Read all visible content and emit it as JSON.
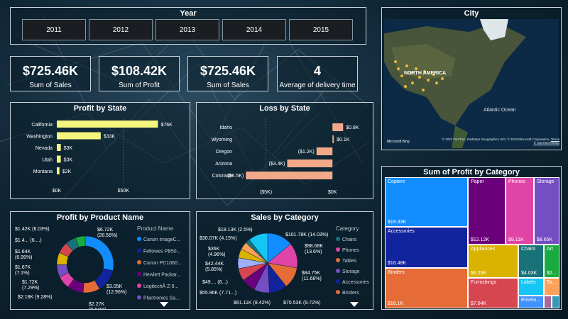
{
  "year_filter": {
    "title": "Year",
    "years": [
      "2011",
      "2012",
      "2013",
      "2014",
      "2015"
    ]
  },
  "kpis": [
    {
      "value": "$725.46K",
      "label": "Sum of Sales"
    },
    {
      "value": "$108.42K",
      "label": "Sum of Profit"
    },
    {
      "value": "$725.46K",
      "label": "Sum of Sales"
    },
    {
      "value": "4",
      "label": "Average of delivery time"
    }
  ],
  "city_map": {
    "title": "City",
    "continent": "NORTH AMERICA",
    "ocean": "Atlantic Ocean",
    "copyright": "© 2023 TomTom, Earthstar Geographics SIO, © 2023 Microsoft Corporation,",
    "terms": "Terms",
    "osm": "© OpenStreetMap",
    "bing": "Microsoft Bing"
  },
  "profit_by_state": {
    "title": "Profit by State",
    "chart_data": {
      "type": "bar",
      "orientation": "horizontal",
      "categories": [
        "California",
        "Washington",
        "Nevada",
        "Utah",
        "Montana"
      ],
      "values": [
        76,
        33,
        3,
        3,
        2
      ],
      "labels": [
        "$76K",
        "$33K",
        "$3K",
        "$3K",
        "$2K"
      ],
      "xticks": [
        "$0K",
        "$50K"
      ],
      "xlim": [
        0,
        80
      ],
      "color": "#f4f67d"
    }
  },
  "loss_by_state": {
    "title": "Loss by State",
    "chart_data": {
      "type": "bar",
      "orientation": "horizontal",
      "categories": [
        "Idaho",
        "Wyoming",
        "Oregon",
        "Arizona",
        "Colorado"
      ],
      "values": [
        0.8,
        0.1,
        -1.2,
        -3.4,
        -6.5
      ],
      "labels": [
        "$0.8K",
        "$0.1K",
        "($1.2K)",
        "($3.4K)",
        "($6.5K)"
      ],
      "xticks": [
        "($5K)",
        "$0K"
      ],
      "xlim": [
        -7,
        1
      ],
      "color": "#f2a98a"
    }
  },
  "profit_by_category": {
    "title": "Sum of Profit by Category",
    "chart_data": {
      "type": "treemap",
      "items": [
        {
          "name": "Copiers",
          "value": "$19.33K",
          "color": "#118dff"
        },
        {
          "name": "Accessories",
          "value": "$16.48K",
          "color": "#12239e"
        },
        {
          "name": "Binders",
          "value": "$16.1K",
          "color": "#e66c37"
        },
        {
          "name": "Paper",
          "value": "$12.12K",
          "color": "#6b007b"
        },
        {
          "name": "Phones",
          "value": "$9.11K",
          "color": "#e044a7"
        },
        {
          "name": "Storage",
          "value": "$8.65K",
          "color": "#744ec2"
        },
        {
          "name": "Appliances",
          "value": "$8.26K",
          "color": "#d9b300"
        },
        {
          "name": "Chairs",
          "value": "$4.03K",
          "color": "#197278"
        },
        {
          "name": "Art",
          "value": "$2...",
          "color": "#1aab40"
        },
        {
          "name": "Furnishings",
          "value": "$7.64K",
          "color": "#d64550"
        },
        {
          "name": "Labels",
          "value": "",
          "color": "#15c6f4"
        },
        {
          "name": "Envelo...",
          "value": "",
          "color": "#4092ff"
        },
        {
          "name": "Ta...",
          "value": "",
          "color": "#ffa058"
        }
      ]
    }
  },
  "profit_by_product": {
    "title": "Profit by Product Name",
    "legend_title": "Product Name",
    "chart_data": {
      "type": "pie",
      "donut": true,
      "values": [
        28.56,
        12.96,
        9.64,
        9.28,
        7.29,
        7.1,
        6.99,
        6.5,
        6.03,
        5.65
      ],
      "colors": [
        "#118dff",
        "#12239e",
        "#e66c37",
        "#6b007b",
        "#e044a7",
        "#744ec2",
        "#d9b300",
        "#d64550",
        "#197278",
        "#1aab40"
      ],
      "labels": [
        {
          "text": "$6.72K",
          "sub": "(28.56%)"
        },
        {
          "text": "$3.05K",
          "sub": "(12.96%)"
        },
        {
          "text": "$2.27K",
          "sub": "(9.64%)"
        },
        {
          "text": "$2.18K (9.28%)",
          "sub": ""
        },
        {
          "text": "$1.72K",
          "sub": "(7.29%)"
        },
        {
          "text": "$1.67K",
          "sub": "(7.1%)"
        },
        {
          "text": "$1.64K",
          "sub": "(6.99%)"
        },
        {
          "text": "$1.4... (6....)",
          "sub": ""
        },
        {
          "text": "$1.42K (6.03%)",
          "sub": ""
        }
      ],
      "legend": [
        "Canon imageC...",
        "Fellowes PB50...",
        "Canon PC1060...",
        "Hewlett Packar...",
        "LogitechÂ Z-9...",
        "Plantronics Sa..."
      ]
    }
  },
  "sales_by_category": {
    "title": "Sales by Category",
    "legend_title": "Category",
    "chart_data": {
      "type": "pie",
      "donut": false,
      "values": [
        14.03,
        13.6,
        11.68,
        9.72,
        8.42,
        7.71,
        6.8,
        5.85,
        4.96,
        4.15,
        2.5,
        10.58
      ],
      "colors": [
        "#118dff",
        "#e044a7",
        "#e66c37",
        "#12239e",
        "#744ec2",
        "#6b007b",
        "#d64550",
        "#a0b0ff",
        "#d9b300",
        "#ffa058",
        "#197278",
        "#15c6f4"
      ],
      "labels": [
        {
          "text": "$101.78K (14.03%)",
          "sub": ""
        },
        {
          "text": "$98.68K",
          "sub": "(13.6%)"
        },
        {
          "text": "$84.75K",
          "sub": "(11.68%)"
        },
        {
          "text": "$70.53K (9.72%)",
          "sub": ""
        },
        {
          "text": "$61.11K (8.42%)",
          "sub": ""
        },
        {
          "text": "$55.96K (7.71...)",
          "sub": ""
        },
        {
          "text": "$49.... (6...)",
          "sub": ""
        },
        {
          "text": "$42.44K",
          "sub": "(5.85%)"
        },
        {
          "text": "$36K",
          "sub": "(4.96%)"
        },
        {
          "text": "$30.07K (4.15%)",
          "sub": ""
        },
        {
          "text": "$18.13K (2.5%)",
          "sub": ""
        }
      ],
      "legend": [
        "Chairs",
        "Phones",
        "Tables",
        "Storage",
        "Accessories",
        "Binders"
      ],
      "legend_colors": [
        "#197278",
        "#e044a7",
        "#e66c37",
        "#744ec2",
        "#12239e",
        "#e66c37"
      ]
    }
  }
}
